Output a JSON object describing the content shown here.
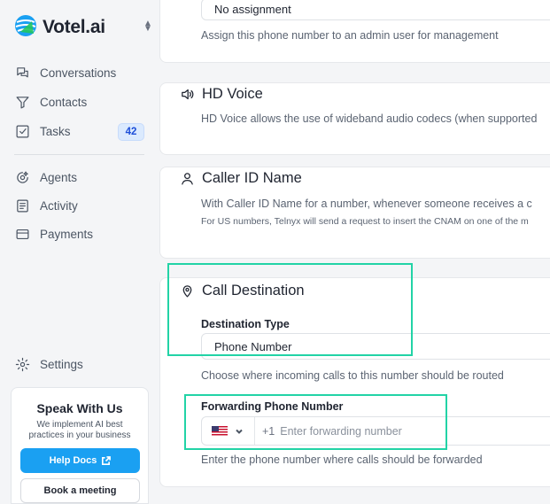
{
  "brand": {
    "name": "Votel.ai"
  },
  "sidebar": {
    "items": [
      {
        "label": "Conversations",
        "icon": "chat-icon"
      },
      {
        "label": "Contacts",
        "icon": "filter-icon"
      },
      {
        "label": "Tasks",
        "icon": "checkbox-icon",
        "badge": "42"
      },
      {
        "label": "Agents",
        "icon": "agent-icon"
      },
      {
        "label": "Activity",
        "icon": "activity-icon"
      },
      {
        "label": "Payments",
        "icon": "card-icon"
      },
      {
        "label": "Settings",
        "icon": "gear-icon"
      }
    ]
  },
  "promo": {
    "title": "Speak With Us",
    "text": "We implement AI best practices in your business",
    "help_label": "Help Docs",
    "meet_label": "Book a meeting"
  },
  "assignment": {
    "value": "No assignment",
    "description": "Assign this phone number to an admin user for management"
  },
  "hd_voice": {
    "title": "HD Voice",
    "description": "HD Voice allows the use of wideband audio codecs (when supported"
  },
  "caller_id": {
    "title": "Caller ID Name",
    "description": "With Caller ID Name for a number, whenever someone receives a c",
    "note": "For US numbers, Telnyx will send a request to insert the CNAM on one of the m"
  },
  "call_destination": {
    "title": "Call Destination",
    "type_label": "Destination Type",
    "type_value": "Phone Number",
    "type_help": "Choose where incoming calls to this number should be routed",
    "forward_label": "Forwarding Phone Number",
    "country_code": "+1",
    "forward_placeholder": "Enter forwarding number",
    "forward_help": "Enter the phone number where calls should be forwarded"
  },
  "colors": {
    "accent": "#1aa0f2",
    "highlight": "#22d3a6",
    "badge_bg": "#dbeafe"
  }
}
